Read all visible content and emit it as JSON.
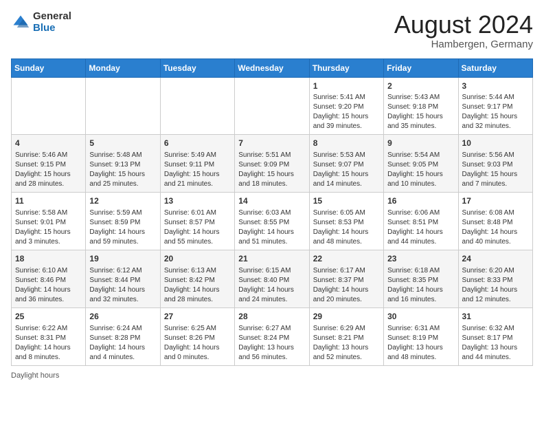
{
  "header": {
    "logo_general": "General",
    "logo_blue": "Blue",
    "month_year": "August 2024",
    "location": "Hambergen, Germany"
  },
  "weekdays": [
    "Sunday",
    "Monday",
    "Tuesday",
    "Wednesday",
    "Thursday",
    "Friday",
    "Saturday"
  ],
  "weeks": [
    [
      {
        "day": "",
        "info": ""
      },
      {
        "day": "",
        "info": ""
      },
      {
        "day": "",
        "info": ""
      },
      {
        "day": "",
        "info": ""
      },
      {
        "day": "1",
        "info": "Sunrise: 5:41 AM\nSunset: 9:20 PM\nDaylight: 15 hours\nand 39 minutes."
      },
      {
        "day": "2",
        "info": "Sunrise: 5:43 AM\nSunset: 9:18 PM\nDaylight: 15 hours\nand 35 minutes."
      },
      {
        "day": "3",
        "info": "Sunrise: 5:44 AM\nSunset: 9:17 PM\nDaylight: 15 hours\nand 32 minutes."
      }
    ],
    [
      {
        "day": "4",
        "info": "Sunrise: 5:46 AM\nSunset: 9:15 PM\nDaylight: 15 hours\nand 28 minutes."
      },
      {
        "day": "5",
        "info": "Sunrise: 5:48 AM\nSunset: 9:13 PM\nDaylight: 15 hours\nand 25 minutes."
      },
      {
        "day": "6",
        "info": "Sunrise: 5:49 AM\nSunset: 9:11 PM\nDaylight: 15 hours\nand 21 minutes."
      },
      {
        "day": "7",
        "info": "Sunrise: 5:51 AM\nSunset: 9:09 PM\nDaylight: 15 hours\nand 18 minutes."
      },
      {
        "day": "8",
        "info": "Sunrise: 5:53 AM\nSunset: 9:07 PM\nDaylight: 15 hours\nand 14 minutes."
      },
      {
        "day": "9",
        "info": "Sunrise: 5:54 AM\nSunset: 9:05 PM\nDaylight: 15 hours\nand 10 minutes."
      },
      {
        "day": "10",
        "info": "Sunrise: 5:56 AM\nSunset: 9:03 PM\nDaylight: 15 hours\nand 7 minutes."
      }
    ],
    [
      {
        "day": "11",
        "info": "Sunrise: 5:58 AM\nSunset: 9:01 PM\nDaylight: 15 hours\nand 3 minutes."
      },
      {
        "day": "12",
        "info": "Sunrise: 5:59 AM\nSunset: 8:59 PM\nDaylight: 14 hours\nand 59 minutes."
      },
      {
        "day": "13",
        "info": "Sunrise: 6:01 AM\nSunset: 8:57 PM\nDaylight: 14 hours\nand 55 minutes."
      },
      {
        "day": "14",
        "info": "Sunrise: 6:03 AM\nSunset: 8:55 PM\nDaylight: 14 hours\nand 51 minutes."
      },
      {
        "day": "15",
        "info": "Sunrise: 6:05 AM\nSunset: 8:53 PM\nDaylight: 14 hours\nand 48 minutes."
      },
      {
        "day": "16",
        "info": "Sunrise: 6:06 AM\nSunset: 8:51 PM\nDaylight: 14 hours\nand 44 minutes."
      },
      {
        "day": "17",
        "info": "Sunrise: 6:08 AM\nSunset: 8:48 PM\nDaylight: 14 hours\nand 40 minutes."
      }
    ],
    [
      {
        "day": "18",
        "info": "Sunrise: 6:10 AM\nSunset: 8:46 PM\nDaylight: 14 hours\nand 36 minutes."
      },
      {
        "day": "19",
        "info": "Sunrise: 6:12 AM\nSunset: 8:44 PM\nDaylight: 14 hours\nand 32 minutes."
      },
      {
        "day": "20",
        "info": "Sunrise: 6:13 AM\nSunset: 8:42 PM\nDaylight: 14 hours\nand 28 minutes."
      },
      {
        "day": "21",
        "info": "Sunrise: 6:15 AM\nSunset: 8:40 PM\nDaylight: 14 hours\nand 24 minutes."
      },
      {
        "day": "22",
        "info": "Sunrise: 6:17 AM\nSunset: 8:37 PM\nDaylight: 14 hours\nand 20 minutes."
      },
      {
        "day": "23",
        "info": "Sunrise: 6:18 AM\nSunset: 8:35 PM\nDaylight: 14 hours\nand 16 minutes."
      },
      {
        "day": "24",
        "info": "Sunrise: 6:20 AM\nSunset: 8:33 PM\nDaylight: 14 hours\nand 12 minutes."
      }
    ],
    [
      {
        "day": "25",
        "info": "Sunrise: 6:22 AM\nSunset: 8:31 PM\nDaylight: 14 hours\nand 8 minutes."
      },
      {
        "day": "26",
        "info": "Sunrise: 6:24 AM\nSunset: 8:28 PM\nDaylight: 14 hours\nand 4 minutes."
      },
      {
        "day": "27",
        "info": "Sunrise: 6:25 AM\nSunset: 8:26 PM\nDaylight: 14 hours\nand 0 minutes."
      },
      {
        "day": "28",
        "info": "Sunrise: 6:27 AM\nSunset: 8:24 PM\nDaylight: 13 hours\nand 56 minutes."
      },
      {
        "day": "29",
        "info": "Sunrise: 6:29 AM\nSunset: 8:21 PM\nDaylight: 13 hours\nand 52 minutes."
      },
      {
        "day": "30",
        "info": "Sunrise: 6:31 AM\nSunset: 8:19 PM\nDaylight: 13 hours\nand 48 minutes."
      },
      {
        "day": "31",
        "info": "Sunrise: 6:32 AM\nSunset: 8:17 PM\nDaylight: 13 hours\nand 44 minutes."
      }
    ]
  ],
  "footer": {
    "daylight_hours": "Daylight hours"
  }
}
